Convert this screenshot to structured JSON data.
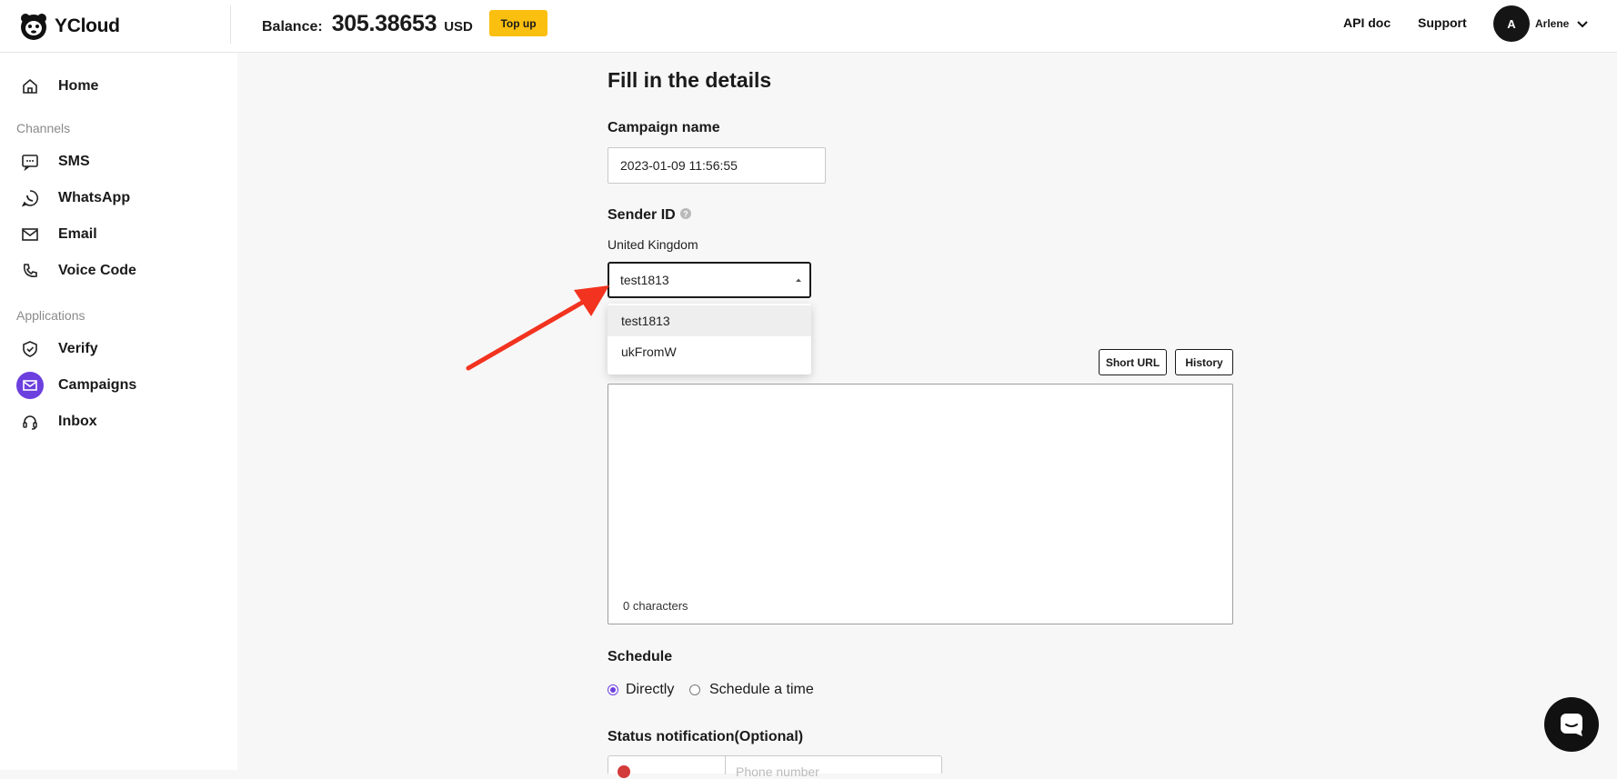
{
  "header": {
    "brand": "YCloud",
    "balance_label": "Balance:",
    "balance_amount": "305.38653",
    "balance_currency": "USD",
    "topup_label": "Top up",
    "api_doc": "API doc",
    "support": "Support",
    "avatar_initial": "A",
    "user_name": "Arlene"
  },
  "sidebar": {
    "home": "Home",
    "channels_title": "Channels",
    "channels": [
      {
        "label": "SMS",
        "icon": "sms-icon"
      },
      {
        "label": "WhatsApp",
        "icon": "whatsapp-icon"
      },
      {
        "label": "Email",
        "icon": "email-icon"
      },
      {
        "label": "Voice Code",
        "icon": "phone-icon"
      }
    ],
    "applications_title": "Applications",
    "applications": [
      {
        "label": "Verify",
        "icon": "shield-icon"
      },
      {
        "label": "Campaigns",
        "icon": "campaigns-icon",
        "active": true
      },
      {
        "label": "Inbox",
        "icon": "headset-icon"
      }
    ]
  },
  "form": {
    "title": "Fill in the details",
    "campaign_name_label": "Campaign name",
    "campaign_name_value": "2023-01-09 11:56:55",
    "sender_id_label": "Sender ID",
    "country": "United Kingdom",
    "sender_selected": "test1813",
    "sender_options": [
      "test1813",
      "ukFromW"
    ],
    "short_url_label": "Short URL",
    "history_label": "History",
    "char_count": "0 characters",
    "schedule_label": "Schedule",
    "schedule_directly": "Directly",
    "schedule_time": "Schedule a time",
    "status_label": "Status notification(Optional)",
    "phone_placeholder": "Phone number"
  },
  "colors": {
    "accent": "#6c3fdf",
    "topup": "#fbbf10",
    "arrow": "#f2331f"
  }
}
